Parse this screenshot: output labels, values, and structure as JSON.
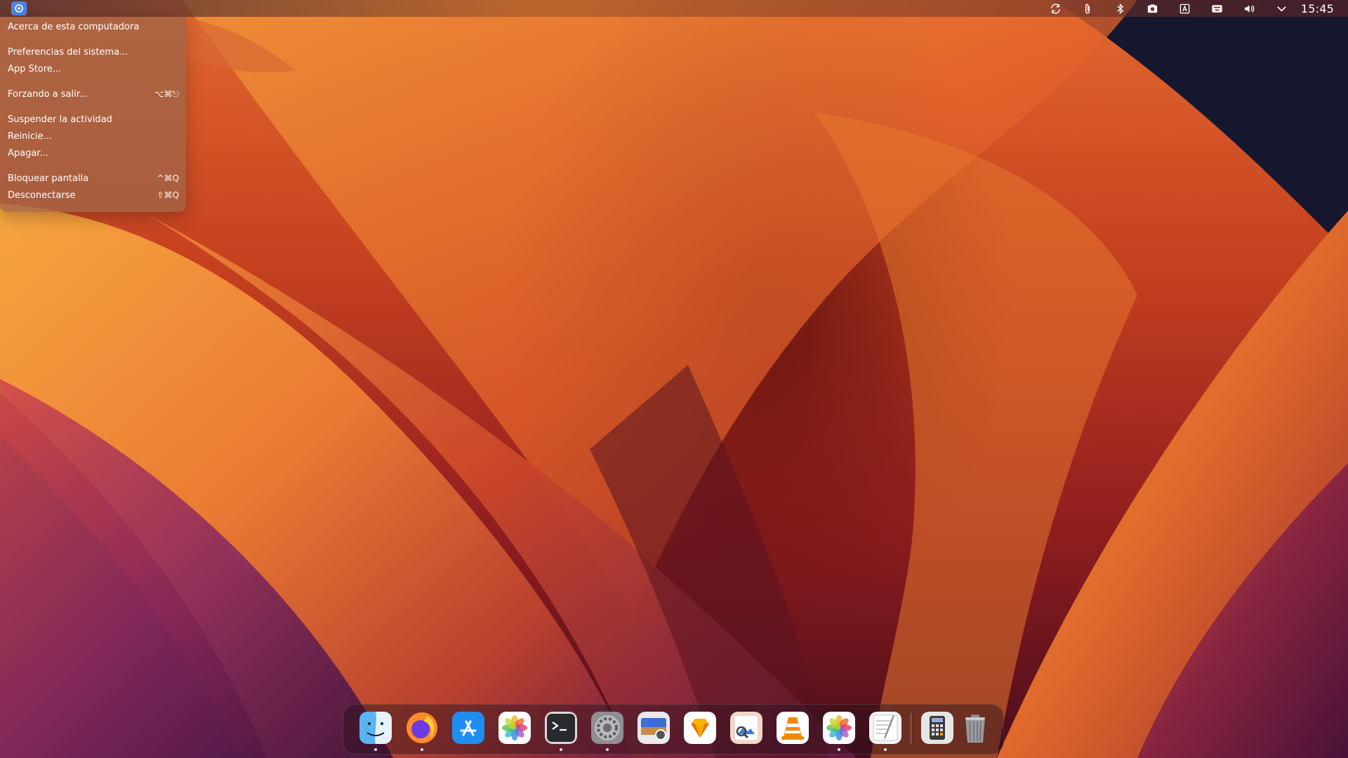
{
  "menubar": {
    "clock": "15:45",
    "tray_icons": [
      "sync-icon",
      "paperclip-icon",
      "bluetooth-icon",
      "screenshot-icon",
      "text-input-icon",
      "keyboard-icon",
      "volume-icon",
      "chevron-down-icon"
    ]
  },
  "apple_menu": {
    "items": [
      {
        "label": "Acerca de esta computadora",
        "shortcut": ""
      },
      {
        "label": "Preferencias del sistema...",
        "shortcut": ""
      },
      {
        "label": "App Store...",
        "shortcut": ""
      },
      {
        "label": "Forzando a salir...",
        "shortcut": "⌥⌘⎋"
      },
      {
        "label": "Suspender la actividad",
        "shortcut": ""
      },
      {
        "label": "Reinicie...",
        "shortcut": ""
      },
      {
        "label": "Apagar...",
        "shortcut": ""
      },
      {
        "label": "Bloquear pantalla",
        "shortcut": "^⌘Q"
      },
      {
        "label": "Desconectarse",
        "shortcut": "⇧⌘Q"
      }
    ]
  },
  "dock": {
    "apps": [
      {
        "name": "finder",
        "running": true
      },
      {
        "name": "firefox",
        "running": true
      },
      {
        "name": "app-store",
        "running": false
      },
      {
        "name": "photos",
        "running": false
      },
      {
        "name": "terminal",
        "running": true
      },
      {
        "name": "system-preferences",
        "running": true
      },
      {
        "name": "screen-capture",
        "running": false
      },
      {
        "name": "sketch",
        "running": false
      },
      {
        "name": "preview",
        "running": false
      },
      {
        "name": "vlc",
        "running": false
      },
      {
        "name": "photos-2",
        "running": true
      },
      {
        "name": "text-editor",
        "running": true
      },
      {
        "name": "calculator",
        "running": false
      },
      {
        "name": "trash",
        "running": false
      }
    ]
  },
  "colors": {
    "menubar_text": "#ffffff",
    "apple_button": "#4a86e8",
    "menu_background": "#a0644699"
  }
}
